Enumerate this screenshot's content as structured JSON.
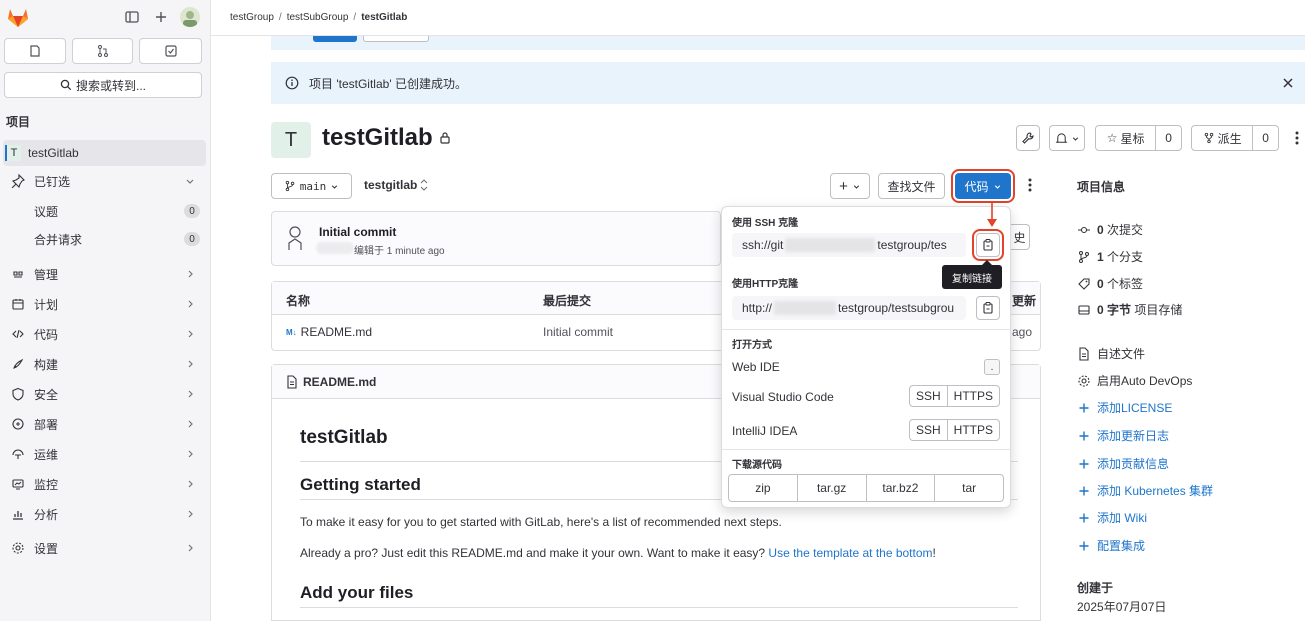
{
  "sidebar": {
    "search_label": "搜索或转到...",
    "section_title": "项目",
    "project_initial": "T",
    "project_name": "testGitlab",
    "pinned_label": "已钉选",
    "issues_label": "议题",
    "issues_count": "0",
    "mr_label": "合并请求",
    "mr_count": "0",
    "nav": [
      {
        "label": "管理",
        "icon": "manage-icon"
      },
      {
        "label": "计划",
        "icon": "plan-icon"
      },
      {
        "label": "代码",
        "icon": "code-icon"
      },
      {
        "label": "构建",
        "icon": "build-icon"
      },
      {
        "label": "安全",
        "icon": "shield-icon"
      },
      {
        "label": "部署",
        "icon": "deploy-icon"
      },
      {
        "label": "运维",
        "icon": "operate-icon"
      },
      {
        "label": "监控",
        "icon": "monitor-icon"
      },
      {
        "label": "分析",
        "icon": "analytics-icon"
      },
      {
        "label": "设置",
        "icon": "gear-icon"
      }
    ]
  },
  "breadcrumb": {
    "group": "testGroup",
    "subgroup": "testSubGroup",
    "project": "testGitlab",
    "separator": "/"
  },
  "alert": {
    "text": "项目 'testGitlab' 已创建成功。",
    "close": "×"
  },
  "project": {
    "initial": "T",
    "title": "testGitlab",
    "star_label": "星标",
    "star_count": "0",
    "fork_label": "派生",
    "fork_count": "0"
  },
  "toolbar": {
    "branch": "main",
    "path": "testgitlab",
    "find_file": "查找文件",
    "code": "代码",
    "plus": "+"
  },
  "commit": {
    "title": "Initial commit",
    "meta": "编辑于 1 minute ago",
    "history_fragment": "史"
  },
  "files": {
    "col_name": "名称",
    "col_last_commit": "最后提交",
    "col_updated_fragment": "更新",
    "rows": [
      {
        "name": "README.md",
        "commit": "Initial commit",
        "updated_fragment": "ago"
      }
    ]
  },
  "readme": {
    "filename": "README.md",
    "h1": "testGitlab",
    "h2_started": "Getting started",
    "p1": "To make it easy for you to get started with GitLab, here's a list of recommended next steps.",
    "p2_prefix": "Already a pro? Just edit this README.md and make it your own. Want to make it easy? ",
    "p2_link": "Use the template at the bottom",
    "p2_suffix": "!",
    "h2_files": "Add your files"
  },
  "dropdown": {
    "ssh_label": "使用 SSH 克隆",
    "ssh_prefix": "ssh://git",
    "ssh_suffix": "testgroup/tes",
    "http_label": "使用HTTP克隆",
    "http_prefix": "http://",
    "http_suffix": "testgroup/testsubgrou",
    "open_label": "打开方式",
    "webide": "Web IDE",
    "webide_key": ".",
    "vscode": "Visual Studio Code",
    "intellij": "IntelliJ IDEA",
    "ssh": "SSH",
    "https": "HTTPS",
    "download_label": "下载源代码",
    "formats": [
      "zip",
      "tar.gz",
      "tar.bz2",
      "tar"
    ]
  },
  "tooltip": "复制链接",
  "right_panel": {
    "title": "项目信息",
    "commits_count": "0",
    "commits_label": "次提交",
    "branches_count": "1",
    "branches_label": "个分支",
    "tags_count": "0",
    "tags_label": "个标签",
    "storage_count": "0 字节",
    "storage_label": "项目存储",
    "readme_link": "自述文件",
    "autodevops": "启用Auto DevOps",
    "links": [
      "添加LICENSE",
      "添加更新日志",
      "添加贡献信息",
      "添加 Kubernetes 集群",
      "添加 Wiki",
      "配置集成"
    ],
    "created_label": "创建于",
    "created_date": "2025年07月07日"
  },
  "colors": {
    "accent": "#1f75cb",
    "annotation": "#e24329",
    "sidebar_bg": "#f5f5f7",
    "alert_bg": "#e9f3fc"
  }
}
